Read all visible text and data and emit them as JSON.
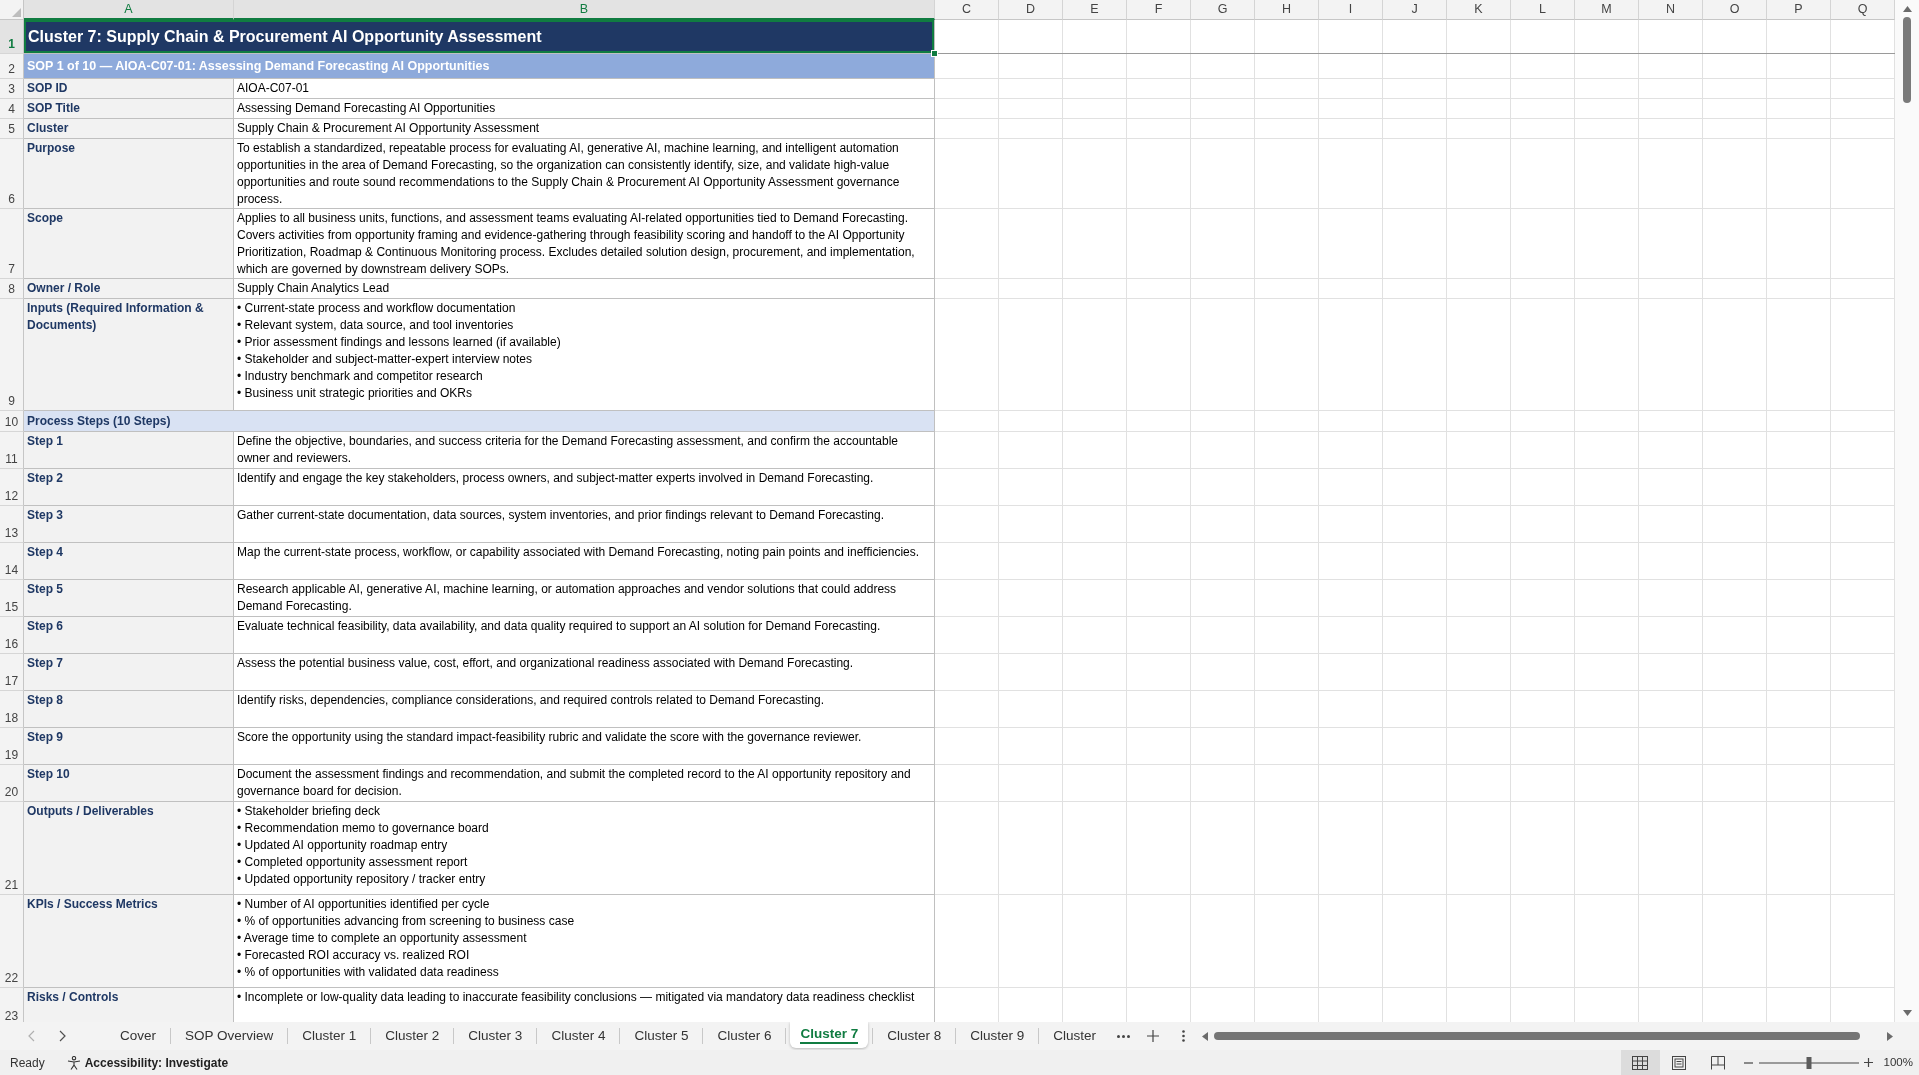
{
  "sheet": {
    "columns": [
      {
        "label": "A",
        "selected": true
      },
      {
        "label": "B",
        "selected": true
      },
      {
        "label": "C",
        "selected": false
      },
      {
        "label": "D",
        "selected": false
      },
      {
        "label": "E",
        "selected": false
      },
      {
        "label": "F",
        "selected": false
      },
      {
        "label": "G",
        "selected": false
      },
      {
        "label": "H",
        "selected": false
      },
      {
        "label": "I",
        "selected": false
      },
      {
        "label": "J",
        "selected": false
      },
      {
        "label": "K",
        "selected": false
      },
      {
        "label": "L",
        "selected": false
      },
      {
        "label": "M",
        "selected": false
      },
      {
        "label": "N",
        "selected": false
      },
      {
        "label": "O",
        "selected": false
      },
      {
        "label": "P",
        "selected": false
      },
      {
        "label": "Q",
        "selected": false
      }
    ],
    "rows": [
      {
        "number": "1",
        "selected": true,
        "kind": "title",
        "text": "Cluster 7: Supply Chain & Procurement AI Opportunity Assessment"
      },
      {
        "number": "2",
        "selected": false,
        "kind": "subtitle",
        "text": "SOP 1 of 10 — AIOA-C07-01: Assessing Demand Forecasting AI Opportunities"
      },
      {
        "number": "3",
        "selected": false,
        "kind": "field",
        "label": "SOP ID",
        "value": "AIOA-C07-01"
      },
      {
        "number": "4",
        "selected": false,
        "kind": "field",
        "label": "SOP Title",
        "value": "Assessing Demand Forecasting AI Opportunities"
      },
      {
        "number": "5",
        "selected": false,
        "kind": "field",
        "label": "Cluster",
        "value": "Supply Chain & Procurement AI Opportunity Assessment"
      },
      {
        "number": "6",
        "selected": false,
        "kind": "field",
        "label": "Purpose",
        "value": "To establish a standardized, repeatable process for evaluating AI, generative AI, machine learning, and intelligent automation opportunities in the area of Demand Forecasting, so the organization can consistently identify, size, and validate high-value opportunities and route sound recommendations to the Supply Chain & Procurement AI Opportunity Assessment governance process."
      },
      {
        "number": "7",
        "selected": false,
        "kind": "field",
        "label": "Scope",
        "value": "Applies to all business units, functions, and assessment teams evaluating AI-related opportunities tied to Demand Forecasting. Covers activities from opportunity framing and evidence-gathering through feasibility scoring and handoff to the AI Opportunity Prioritization, Roadmap & Continuous Monitoring process. Excludes detailed solution design, procurement, and implementation, which are governed by downstream delivery SOPs."
      },
      {
        "number": "8",
        "selected": false,
        "kind": "field",
        "label": "Owner / Role",
        "value": "Supply Chain Analytics Lead"
      },
      {
        "number": "9",
        "selected": false,
        "kind": "list",
        "label": "Inputs (Required Information & Documents)",
        "items": [
          "• Current-state process and workflow documentation",
          "• Relevant system, data source, and tool inventories",
          "• Prior assessment findings and lessons learned (if available)",
          "• Stakeholder and subject-matter-expert interview notes",
          "• Industry benchmark and competitor research",
          "• Business unit strategic priorities and OKRs"
        ]
      },
      {
        "number": "10",
        "selected": false,
        "kind": "section",
        "text": "Process Steps (10 Steps)"
      },
      {
        "number": "11",
        "selected": false,
        "kind": "field",
        "label": "Step 1",
        "value": "Define the objective, boundaries, and success criteria for the Demand Forecasting assessment, and confirm the accountable owner and reviewers."
      },
      {
        "number": "12",
        "selected": false,
        "kind": "field",
        "label": "Step 2",
        "value": "Identify and engage the key stakeholders, process owners, and subject-matter experts involved in Demand Forecasting."
      },
      {
        "number": "13",
        "selected": false,
        "kind": "field",
        "label": "Step 3",
        "value": "Gather current-state documentation, data sources, system inventories, and prior findings relevant to Demand Forecasting."
      },
      {
        "number": "14",
        "selected": false,
        "kind": "field",
        "label": "Step 4",
        "value": "Map the current-state process, workflow, or capability associated with Demand Forecasting, noting pain points and inefficiencies."
      },
      {
        "number": "15",
        "selected": false,
        "kind": "field",
        "label": "Step 5",
        "value": "Research applicable AI, generative AI, machine learning, or automation approaches and vendor solutions that could address Demand Forecasting."
      },
      {
        "number": "16",
        "selected": false,
        "kind": "field",
        "label": "Step 6",
        "value": "Evaluate technical feasibility, data availability, and data quality required to support an AI solution for Demand Forecasting."
      },
      {
        "number": "17",
        "selected": false,
        "kind": "field",
        "label": "Step 7",
        "value": "Assess the potential business value, cost, effort, and organizational readiness associated with Demand Forecasting."
      },
      {
        "number": "18",
        "selected": false,
        "kind": "field",
        "label": "Step 8",
        "value": "Identify risks, dependencies, compliance considerations, and required controls related to Demand Forecasting."
      },
      {
        "number": "19",
        "selected": false,
        "kind": "field",
        "label": "Step 9",
        "value": "Score the opportunity using the standard impact-feasibility rubric and validate the score with the governance reviewer."
      },
      {
        "number": "20",
        "selected": false,
        "kind": "field",
        "label": "Step 10",
        "value": "Document the assessment findings and recommendation, and submit the completed record to the AI opportunity repository and governance board for decision."
      },
      {
        "number": "21",
        "selected": false,
        "kind": "list",
        "label": "Outputs / Deliverables",
        "items": [
          "• Stakeholder briefing deck",
          "• Recommendation memo to governance board",
          "• Updated AI opportunity roadmap entry",
          "• Completed opportunity assessment report",
          "• Updated opportunity repository / tracker entry"
        ]
      },
      {
        "number": "22",
        "selected": false,
        "kind": "list",
        "label": "KPIs / Success Metrics",
        "items": [
          "• Number of AI opportunities identified per cycle",
          "• % of opportunities advancing from screening to business case",
          "• Average time to complete an opportunity assessment",
          "• Forecasted ROI accuracy vs. realized ROI",
          "• % of opportunities with validated data readiness"
        ]
      },
      {
        "number": "23",
        "selected": false,
        "kind": "list",
        "label": "Risks / Controls",
        "items": [
          "• Incomplete or low-quality data leading to inaccurate feasibility conclusions — mitigated via mandatory data readiness checklist"
        ]
      }
    ]
  },
  "tab_nav": [
    {
      "kind": "previous",
      "disabled": true
    },
    {
      "kind": "next",
      "disabled": false
    }
  ],
  "tabs": [
    {
      "label": "Cover",
      "selected": false
    },
    {
      "label": "SOP Overview",
      "selected": false
    },
    {
      "label": "Cluster 1",
      "selected": false
    },
    {
      "label": "Cluster 2",
      "selected": false
    },
    {
      "label": "Cluster 3",
      "selected": false
    },
    {
      "label": "Cluster 4",
      "selected": false
    },
    {
      "label": "Cluster 5",
      "selected": false
    },
    {
      "label": "Cluster 6",
      "selected": false
    },
    {
      "label": "Cluster 7",
      "selected": true
    },
    {
      "label": "Cluster 8",
      "selected": false
    },
    {
      "label": "Cluster 9",
      "selected": false
    },
    {
      "label": "Cluster",
      "selected": false
    }
  ],
  "status_bar": {
    "status": "Ready",
    "accessibility": "Accessibility: Investigate",
    "views": [
      {
        "kind": "normal",
        "selected": true
      },
      {
        "kind": "page_layout",
        "selected": false
      },
      {
        "kind": "page_break",
        "selected": false
      }
    ],
    "zoom": {
      "level": 0.5,
      "reading": "100%"
    }
  }
}
